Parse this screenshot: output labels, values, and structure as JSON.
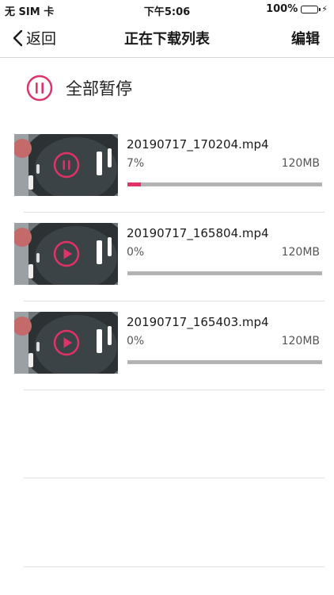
{
  "status_bar": {
    "carrier": "无 SIM 卡",
    "time": "下午5:06",
    "battery": "100%"
  },
  "nav": {
    "back_label": "返回",
    "title": "正在下载列表",
    "edit_label": "编辑"
  },
  "pause_all": {
    "label": "全部暂停",
    "icon": "pause-circle-icon"
  },
  "downloads": [
    {
      "filename": "20190717_170204.mp4",
      "percent_text": "7%",
      "size": "120MB",
      "progress": 0.07,
      "state": "downloading",
      "icon": "pause-icon"
    },
    {
      "filename": "20190717_165804.mp4",
      "percent_text": "0%",
      "size": "120MB",
      "progress": 0.0,
      "state": "paused",
      "icon": "play-icon"
    },
    {
      "filename": "20190717_165403.mp4",
      "percent_text": "0%",
      "size": "120MB",
      "progress": 0.0,
      "state": "paused",
      "icon": "play-icon"
    }
  ],
  "colors": {
    "accent": "#e0336a",
    "progress_track": "#b3b3b3",
    "battery_green": "#4cd964"
  }
}
